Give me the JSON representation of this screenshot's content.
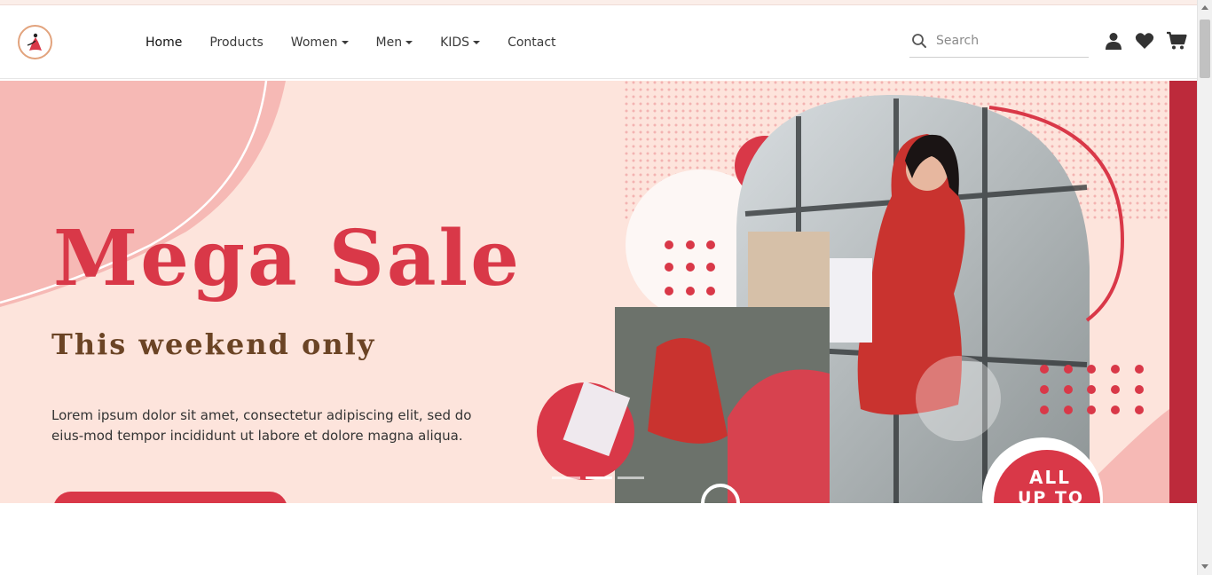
{
  "brand": {
    "logo_icon": "dress-logo-icon"
  },
  "nav": {
    "items": [
      {
        "label": "Home",
        "dropdown": false,
        "active": true
      },
      {
        "label": "Products",
        "dropdown": false,
        "active": false
      },
      {
        "label": "Women",
        "dropdown": true,
        "active": false
      },
      {
        "label": "Men",
        "dropdown": true,
        "active": false
      },
      {
        "label": "KIDS",
        "dropdown": true,
        "active": false
      },
      {
        "label": "Contact",
        "dropdown": false,
        "active": false
      }
    ]
  },
  "search": {
    "placeholder": "Search",
    "icon": "search-icon"
  },
  "header_icons": [
    "user-icon",
    "heart-icon",
    "cart-icon"
  ],
  "hero": {
    "title": "Mega Sale",
    "subtitle": "This weekend only",
    "text": "Lorem ipsum dolor sit amet, consectetur adipiscing elit, sed do eius-mod tempor incididunt ut labore et dolore magna aliqua.",
    "badge_line1": "ALL",
    "badge_line2": "UP TO",
    "carousel_count": 3,
    "carousel_active": 1
  },
  "colors": {
    "accent": "#d93848",
    "hero_bg": "#fde4dc",
    "subtitle": "#6b4425",
    "brand_ring": "#e2a37d"
  }
}
